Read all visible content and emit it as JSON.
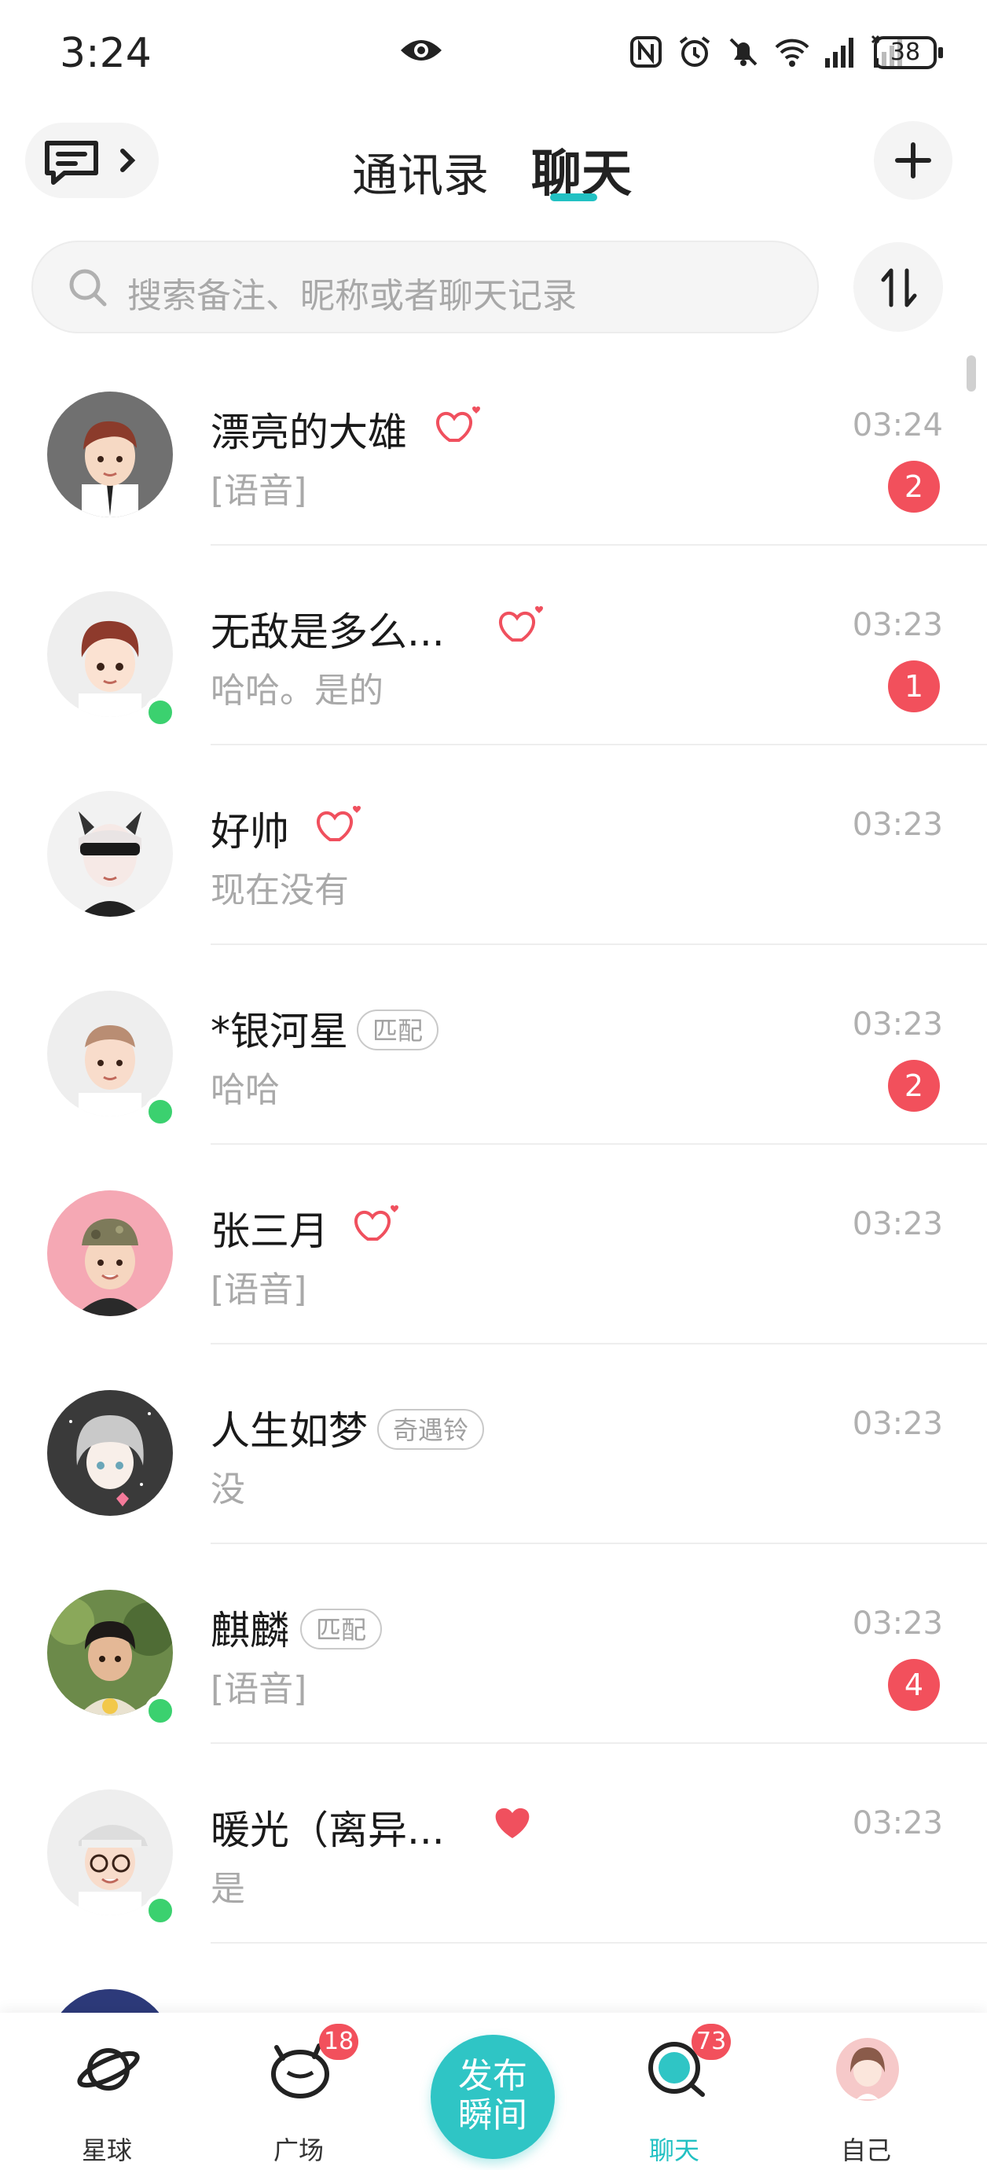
{
  "status_bar": {
    "time": "3:24",
    "battery": "38"
  },
  "header": {
    "tabs": [
      {
        "label": "通讯录"
      },
      {
        "label": "聊天"
      }
    ]
  },
  "search": {
    "placeholder": "搜索备注、昵称或者聊天记录"
  },
  "chats": [
    {
      "name": "漂亮的大雄",
      "preview": "[语音]",
      "time": "03:24",
      "unread": "2",
      "heart": "outline",
      "online": false
    },
    {
      "name": "无敌是多么...",
      "preview": "哈哈。是的",
      "time": "03:23",
      "unread": "1",
      "heart": "outline",
      "online": true
    },
    {
      "name": "好帅",
      "preview": "现在没有",
      "time": "03:23",
      "unread": "",
      "heart": "outline",
      "online": false
    },
    {
      "name": "*银河星",
      "tag": "匹配",
      "preview": "哈哈",
      "time": "03:23",
      "unread": "2",
      "online": true
    },
    {
      "name": "张三月",
      "preview": "[语音]",
      "time": "03:23",
      "unread": "",
      "heart": "outline",
      "online": false
    },
    {
      "name": "人生如梦",
      "tag": "奇遇铃",
      "preview": "没",
      "time": "03:23",
      "unread": "",
      "online": false
    },
    {
      "name": "麒麟",
      "tag": "匹配",
      "preview": "[语音]",
      "time": "03:23",
      "unread": "4",
      "online": true
    },
    {
      "name": "暖光（离异...",
      "preview": "是",
      "time": "03:23",
      "unread": "",
      "heart": "filled",
      "online": true
    }
  ],
  "bottom_nav": {
    "items": [
      {
        "label": "星球"
      },
      {
        "label": "广场",
        "badge": "18"
      },
      {
        "label": "聊天",
        "badge": "73"
      },
      {
        "label": "自己"
      }
    ],
    "publish_line1": "发布",
    "publish_line2": "瞬间"
  },
  "colors": {
    "accent": "#22c1c3",
    "badge": "#f2505c",
    "online": "#3bd16f",
    "heart": "#f0505e"
  }
}
